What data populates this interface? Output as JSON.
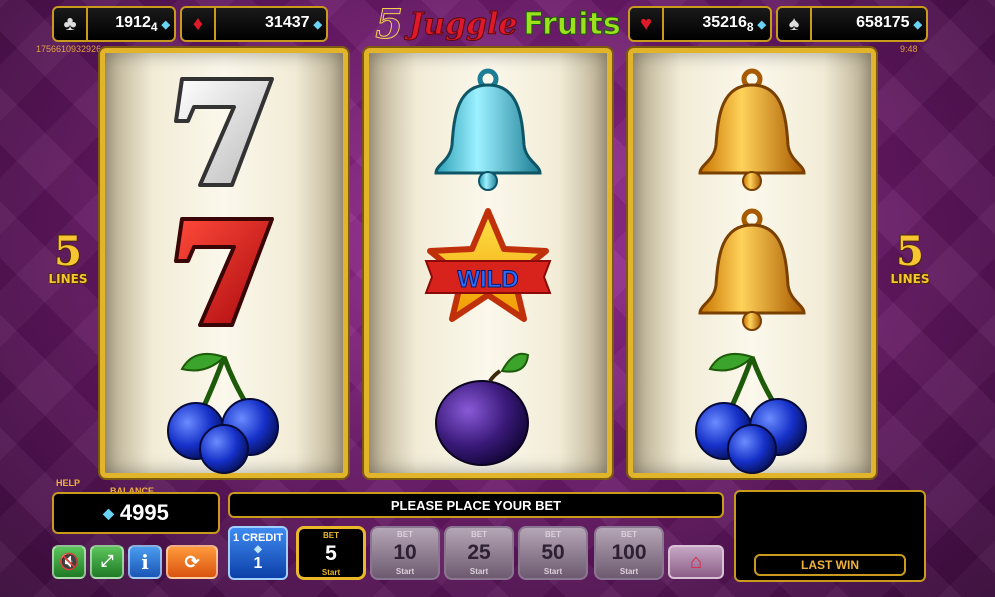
{
  "game": {
    "title_number": "5",
    "title_word1": "Juggle",
    "title_word2": "Fruits"
  },
  "jackpots": [
    {
      "suit": "♣",
      "suit_icon": "club-icon",
      "amount": "1912",
      "sub": "4",
      "color": "#dddddd"
    },
    {
      "suit": "♦",
      "suit_icon": "diamond-suit-icon",
      "amount": "31437",
      "sub": "",
      "color": "#e0192a"
    },
    {
      "suit": "♥",
      "suit_icon": "heart-icon",
      "amount": "35216",
      "sub": "8",
      "color": "#e0192a"
    },
    {
      "suit": "♠",
      "suit_icon": "spade-icon",
      "amount": "658175",
      "sub": "",
      "color": "#dddddd"
    }
  ],
  "ticker_left": "1756610932926",
  "clock": "9:48",
  "lines": {
    "count": "5",
    "label": "LINES"
  },
  "reels": [
    [
      "seven-white",
      "seven-red",
      "cherries"
    ],
    [
      "bell-blue",
      "wild-star",
      "plum"
    ],
    [
      "bell-gold",
      "bell-gold",
      "cherries"
    ]
  ],
  "wild_text": "WILD",
  "bottom": {
    "help_label": "HELP",
    "balance_label": "BALANCE",
    "balance_value": "4995",
    "message": "PLEASE PLACE YOUR BET",
    "last_win_label": "LAST WIN",
    "credit_label": "1 CREDIT",
    "credit_value": "1",
    "bet_label": "BET",
    "start_label": "Start",
    "bets": [
      "5",
      "10",
      "25",
      "50",
      "100"
    ],
    "active_bet_index": 0
  },
  "colors": {
    "gold": "#e2b42a",
    "background": "#6d1a6b",
    "accent_blue": "#3f8cf2"
  }
}
